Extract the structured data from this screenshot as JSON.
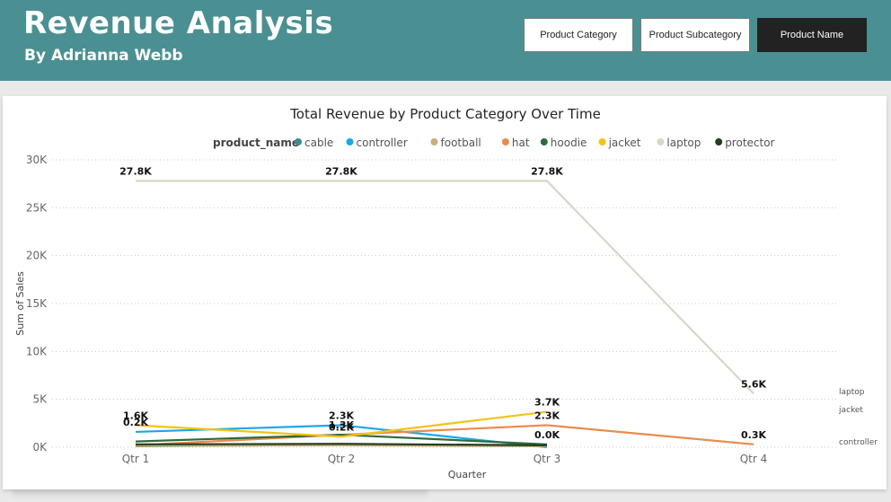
{
  "header": {
    "title": "Revenue Analysis",
    "subtitle": "By Adrianna Webb",
    "buttons": [
      {
        "label": "Product Category",
        "active": false
      },
      {
        "label": "Product Subcategory",
        "active": false
      },
      {
        "label": "Product Name",
        "active": true
      }
    ]
  },
  "chart_data": {
    "type": "line",
    "title": "Total Revenue by Product Category Over Time",
    "xlabel": "Quarter",
    "ylabel": "Sum of Sales",
    "legend_title": "product_name",
    "legend_position": "top",
    "grid": true,
    "ylim": [
      0,
      30000
    ],
    "yticks": [
      {
        "value": 0,
        "label": "0K"
      },
      {
        "value": 5000,
        "label": "5K"
      },
      {
        "value": 10000,
        "label": "10K"
      },
      {
        "value": 15000,
        "label": "15K"
      },
      {
        "value": 20000,
        "label": "20K"
      },
      {
        "value": 25000,
        "label": "25K"
      },
      {
        "value": 30000,
        "label": "30K"
      }
    ],
    "categories": [
      "Qtr 1",
      "Qtr 2",
      "Qtr 3",
      "Qtr 4"
    ],
    "series": [
      {
        "name": "cable",
        "color": "#3d8b8f",
        "values": [
          100,
          250,
          150,
          null
        ]
      },
      {
        "name": "controller",
        "color": "#1ba7e8",
        "values": [
          1600,
          2300,
          0,
          null
        ],
        "end_label": "controller"
      },
      {
        "name": "football",
        "color": "#c8b07a",
        "values": [
          150,
          200,
          100,
          null
        ]
      },
      {
        "name": "hat",
        "color": "#ea8b4c",
        "values": [
          200,
          1300,
          2300,
          300
        ]
      },
      {
        "name": "hoodie",
        "color": "#2e6b3c",
        "values": [
          600,
          1300,
          300,
          null
        ]
      },
      {
        "name": "jacket",
        "color": "#f2c418",
        "values": [
          2300,
          1100,
          3700,
          null
        ],
        "end_label": "jacket"
      },
      {
        "name": "laptop",
        "color": "#d6d8c6",
        "values": [
          27800,
          27800,
          27800,
          5600
        ],
        "end_label": "laptop"
      },
      {
        "name": "protector",
        "color": "#233d21",
        "values": [
          300,
          350,
          200,
          null
        ]
      }
    ],
    "data_labels": [
      {
        "category": "Qtr 1",
        "value": 27800,
        "text": "27.8K"
      },
      {
        "category": "Qtr 2",
        "value": 27800,
        "text": "27.8K"
      },
      {
        "category": "Qtr 3",
        "value": 27800,
        "text": "27.8K"
      },
      {
        "category": "Qtr 4",
        "value": 5600,
        "text": "5.6K"
      },
      {
        "category": "Qtr 1",
        "value": 2300,
        "text": "1.6K"
      },
      {
        "category": "Qtr 1",
        "value": 1600,
        "text": "0.2K"
      },
      {
        "category": "Qtr 2",
        "value": 2300,
        "text": "2.3K"
      },
      {
        "category": "Qtr 2",
        "value": 1300,
        "text": "1.3K"
      },
      {
        "category": "Qtr 2",
        "value": 1100,
        "text": "0.2K"
      },
      {
        "category": "Qtr 3",
        "value": 3700,
        "text": "3.7K"
      },
      {
        "category": "Qtr 3",
        "value": 2300,
        "text": "2.3K"
      },
      {
        "category": "Qtr 3",
        "value": 300,
        "text": "0.0K"
      },
      {
        "category": "Qtr 4",
        "value": 300,
        "text": "0.3K"
      }
    ]
  }
}
